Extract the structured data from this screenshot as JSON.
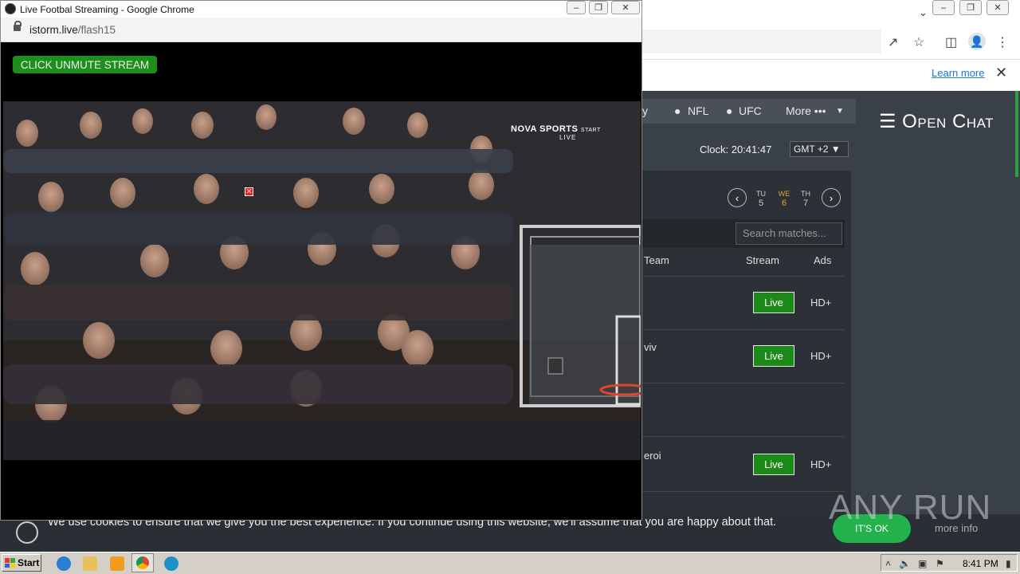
{
  "background_window": {
    "nav": {
      "partial_item": "y",
      "items": [
        "NFL",
        "UFC"
      ],
      "more": "More •••"
    },
    "open_chat": "☰ Open Chat",
    "banner": {
      "learn_more": "Learn more"
    },
    "clock": "Clock: 20:41:47",
    "timezone": "GMT +2",
    "days": [
      {
        "abbr": "TU",
        "num": "5",
        "active": false
      },
      {
        "abbr": "WE",
        "num": "6",
        "active": true
      },
      {
        "abbr": "TH",
        "num": "7",
        "active": false
      }
    ],
    "search_placeholder": "Search matches...",
    "table_headers": {
      "team": "Team",
      "stream": "Stream",
      "ads": "Ads"
    },
    "rows": [
      {
        "team": "",
        "live": "Live",
        "ads": "HD+"
      },
      {
        "team": "viv",
        "live": "Live",
        "ads": "HD+"
      },
      {
        "team": "",
        "live": "",
        "ads": ""
      },
      {
        "team": "eroi",
        "live": "Live",
        "ads": "HD+"
      }
    ],
    "cookie": {
      "text": "We use cookies to ensure that we give you the best experience. If you continue using this website, we'll assume that you are happy about that.",
      "ok": "IT'S OK",
      "more_info": "more info"
    },
    "watermark": "ANY RUN"
  },
  "popup": {
    "title": "Live Footbal Streaming - Google Chrome",
    "url_domain": "istorm.live",
    "url_path": "/flash15",
    "unmute_label": "CLICK UNMUTE STREAM",
    "broadcaster": {
      "brand": "NOVA",
      "sub": "SPORTS",
      "tag": "START",
      "live": "LIVE"
    }
  },
  "taskbar": {
    "start": "Start",
    "time": "8:41 PM"
  },
  "colors": {
    "live_green": "#1b8a19",
    "unmute_green": "#1c8f1c",
    "cookie_ok": "#23b24b",
    "active_day": "#f0a030"
  }
}
